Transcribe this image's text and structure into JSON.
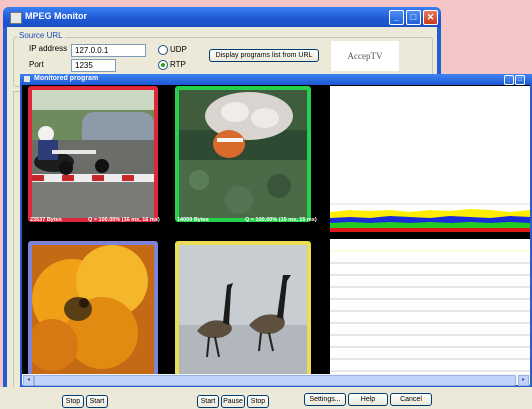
{
  "main_window": {
    "title": "MPEG Monitor",
    "source_group_label": "Source URL",
    "ip_label": "IP address",
    "ip_value": "127.0.0.1",
    "port_label": "Port",
    "port_value": "1235",
    "udp_label": "UDP",
    "rtp_label": "RTP",
    "protocol_selected": "RTP",
    "display_button": "Display programs list from URL",
    "logo_text": "AccepTV"
  },
  "monitor_window": {
    "title": "Monitored program"
  },
  "tiles": [
    {
      "border_color": "#e0263a",
      "stats_left": "23537 Bytes",
      "stats_right": "Q = 100.00% (16 ms, 16 ms)"
    },
    {
      "border_color": "#23d24a",
      "stats_left": "14009 Bytes",
      "stats_right": "Q = 100.00% (15 ms, 15 ms)"
    },
    {
      "border_color": "#7f83d6"
    },
    {
      "border_color": "#eadd55"
    }
  ],
  "bottom_buttons": {
    "stop1": "Stop",
    "start1": "Start",
    "start2": "Start",
    "pause": "Pause",
    "stop2": "Stop",
    "settings": "Settings...",
    "help": "Help",
    "cancel": "Cancel"
  },
  "colors": {
    "titlebar": "#1d58d4",
    "pink_background": "#f4c4c6",
    "level_yellow": "#ffee00",
    "level_blue": "#1c2bd8",
    "level_green": "#22cc22",
    "level_red": "#e01818"
  },
  "controls": {
    "minimize_glyph": "_",
    "maximize_glyph": "□",
    "close_glyph": "✕",
    "scroll_left_glyph": "◂",
    "scroll_right_glyph": "▸"
  }
}
